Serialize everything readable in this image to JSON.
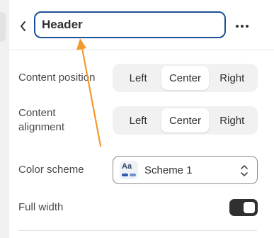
{
  "header": {
    "back_icon": "chevron-left-icon",
    "title_value": "Header",
    "more_icon": "more-horizontal-icon"
  },
  "content_position": {
    "label": "Content position",
    "options": [
      "Left",
      "Center",
      "Right"
    ],
    "selected": "Center"
  },
  "content_alignment": {
    "label": "Content alignment",
    "options": [
      "Left",
      "Center",
      "Right"
    ],
    "selected": "Center"
  },
  "color_scheme": {
    "label": "Color scheme",
    "swatch_text": "Aa",
    "value": "Scheme 1"
  },
  "full_width": {
    "label": "Full width",
    "enabled": true
  },
  "colors": {
    "accent_border": "#1f5199",
    "annotation_arrow": "#f29a2e"
  }
}
